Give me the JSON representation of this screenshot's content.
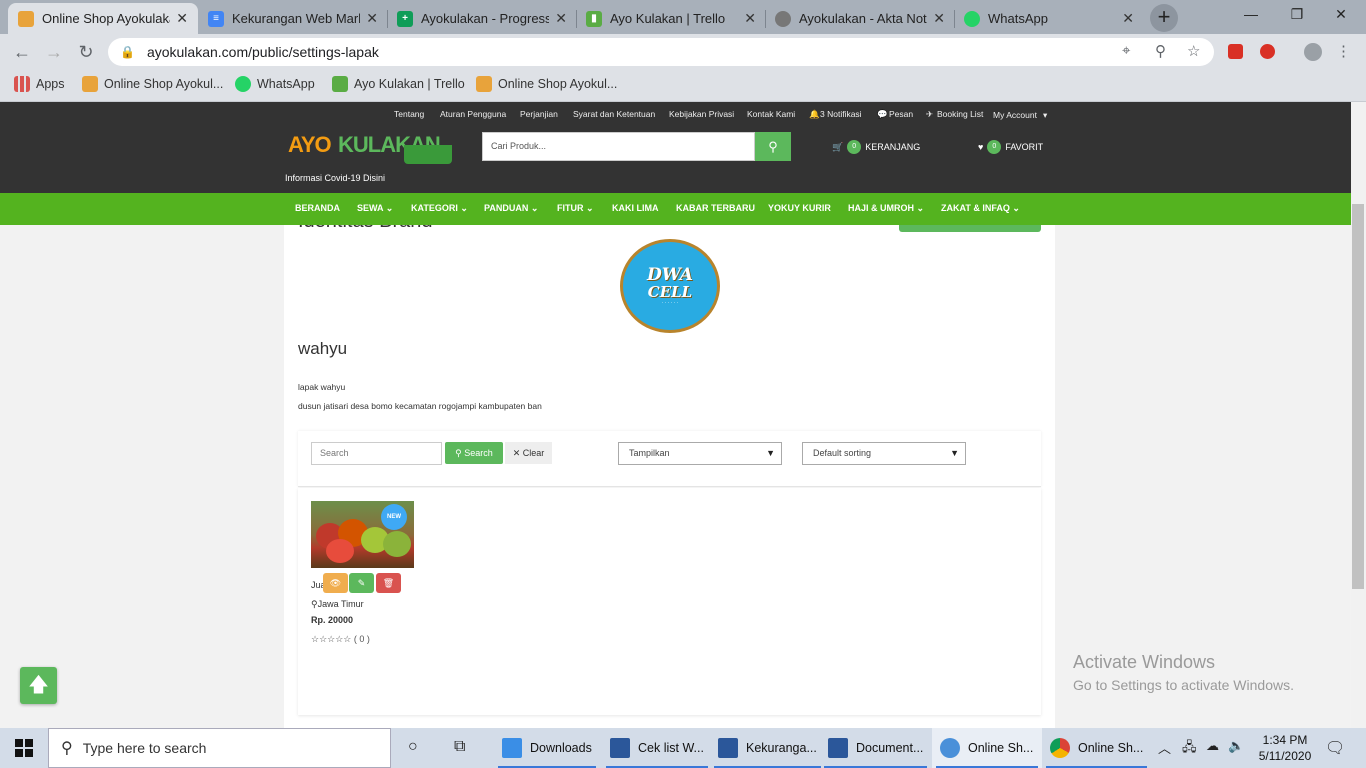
{
  "browser": {
    "tabs": [
      {
        "title": "Online Shop Ayokulakan",
        "fav_color": "#e8a33b",
        "active": true
      },
      {
        "title": "Kekurangan Web Marketplace",
        "fav_color": "#4285f4",
        "active": false
      },
      {
        "title": "Ayokulakan - Progress",
        "fav_color": "#0f9d58",
        "active": false
      },
      {
        "title": "Ayo Kulakan | Trello",
        "fav_color": "#5aac44",
        "active": false
      },
      {
        "title": "Ayokulakan - Akta Notaris",
        "fav_color": "#777777",
        "active": false
      },
      {
        "title": "WhatsApp",
        "fav_color": "#25d366",
        "active": false
      }
    ],
    "url": "ayokulakan.com/public/settings-lapak",
    "bookmarks": [
      {
        "label": "Apps",
        "color": "#d9534f"
      },
      {
        "label": "Online Shop Ayokul...",
        "color": "#e8a33b"
      },
      {
        "label": "WhatsApp",
        "color": "#25d366"
      },
      {
        "label": "Ayo Kulakan | Trello",
        "color": "#5aac44"
      },
      {
        "label": "Online Shop Ayokul...",
        "color": "#e8a33b"
      }
    ]
  },
  "site": {
    "toplinks": [
      "Tentang",
      "Aturan Pengguna",
      "Perjanjian",
      "Syarat dan Ketentuan",
      "Kebijakan Privasi",
      "Kontak Kami",
      "3 Notifikasi",
      "Pesan",
      "Booking List",
      "My Account"
    ],
    "logo_part1": "AYO",
    "logo_part2": "KULAKAN",
    "covid_link": "Informasi Covid-19 Disini",
    "search_placeholder": "Cari Produk...",
    "cart": {
      "count": "0",
      "label": "KERANJANG"
    },
    "favorite": {
      "count": "0",
      "label": "FAVORIT"
    },
    "nav": [
      "BERANDA",
      "SEWA",
      "KATEGORI",
      "PANDUAN",
      "FITUR",
      "KAKI LIMA",
      "KABAR TERBARU",
      "YOKUY KURIR",
      "HAJI & UMROH",
      "ZAKAT & INFAQ"
    ],
    "nav_dropdown": [
      false,
      true,
      true,
      true,
      true,
      false,
      false,
      false,
      true,
      true
    ],
    "accent": "#54b31f"
  },
  "shop": {
    "section_title": "Identitas Brand",
    "logo_line1": "DWA",
    "logo_line2": "CELL",
    "name": "wahyu",
    "description": "lapak wahyu",
    "address": "dusun jatisari desa bomo kecamatan rogojampi kambupaten ban",
    "filter": {
      "search_placeholder": "Search",
      "search_button": "Search",
      "clear_button": "Clear",
      "display_select": "Tampilkan",
      "sort_select": "Default sorting"
    },
    "products": [
      {
        "title": "Jua",
        "badge": "NEW",
        "location": "Jawa Timur",
        "price": "Rp. 20000",
        "rating": "☆☆☆☆☆ ( 0 )"
      }
    ]
  },
  "windows": {
    "activate_title": "Activate Windows",
    "activate_sub": "Go to Settings to activate Windows."
  },
  "taskbar": {
    "search_placeholder": "Type here to search",
    "apps": [
      {
        "label": "Downloads",
        "color": "#3a8ee6"
      },
      {
        "label": "Cek list W...",
        "color": "#2b579a"
      },
      {
        "label": "Kekuranga...",
        "color": "#2b579a"
      },
      {
        "label": "Document...",
        "color": "#2b579a"
      },
      {
        "label": "Online Sh...",
        "color": "#4a90d9"
      },
      {
        "label": "Online Sh...",
        "color": "#db4437"
      }
    ],
    "time": "1:34 PM",
    "date": "5/11/2020"
  }
}
